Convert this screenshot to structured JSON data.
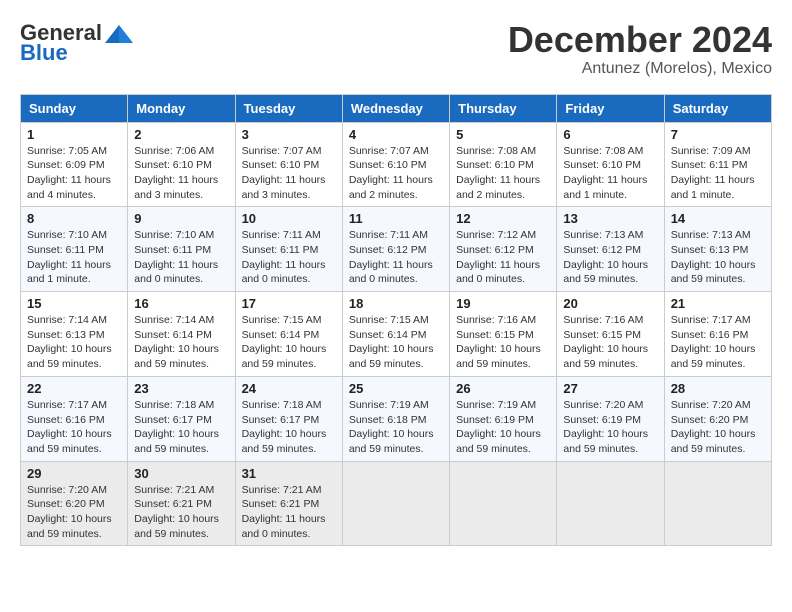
{
  "header": {
    "logo_general": "General",
    "logo_blue": "Blue",
    "month_title": "December 2024",
    "location": "Antunez (Morelos), Mexico"
  },
  "calendar": {
    "days_of_week": [
      "Sunday",
      "Monday",
      "Tuesday",
      "Wednesday",
      "Thursday",
      "Friday",
      "Saturday"
    ],
    "weeks": [
      [
        {
          "day": "",
          "info": ""
        },
        {
          "day": "2",
          "info": "Sunrise: 7:06 AM\nSunset: 6:10 PM\nDaylight: 11 hours\nand 3 minutes."
        },
        {
          "day": "3",
          "info": "Sunrise: 7:07 AM\nSunset: 6:10 PM\nDaylight: 11 hours\nand 3 minutes."
        },
        {
          "day": "4",
          "info": "Sunrise: 7:07 AM\nSunset: 6:10 PM\nDaylight: 11 hours\nand 2 minutes."
        },
        {
          "day": "5",
          "info": "Sunrise: 7:08 AM\nSunset: 6:10 PM\nDaylight: 11 hours\nand 2 minutes."
        },
        {
          "day": "6",
          "info": "Sunrise: 7:08 AM\nSunset: 6:10 PM\nDaylight: 11 hours\nand 1 minute."
        },
        {
          "day": "7",
          "info": "Sunrise: 7:09 AM\nSunset: 6:11 PM\nDaylight: 11 hours\nand 1 minute."
        }
      ],
      [
        {
          "day": "8",
          "info": "Sunrise: 7:10 AM\nSunset: 6:11 PM\nDaylight: 11 hours\nand 1 minute."
        },
        {
          "day": "9",
          "info": "Sunrise: 7:10 AM\nSunset: 6:11 PM\nDaylight: 11 hours\nand 0 minutes."
        },
        {
          "day": "10",
          "info": "Sunrise: 7:11 AM\nSunset: 6:11 PM\nDaylight: 11 hours\nand 0 minutes."
        },
        {
          "day": "11",
          "info": "Sunrise: 7:11 AM\nSunset: 6:12 PM\nDaylight: 11 hours\nand 0 minutes."
        },
        {
          "day": "12",
          "info": "Sunrise: 7:12 AM\nSunset: 6:12 PM\nDaylight: 11 hours\nand 0 minutes."
        },
        {
          "day": "13",
          "info": "Sunrise: 7:13 AM\nSunset: 6:12 PM\nDaylight: 10 hours\nand 59 minutes."
        },
        {
          "day": "14",
          "info": "Sunrise: 7:13 AM\nSunset: 6:13 PM\nDaylight: 10 hours\nand 59 minutes."
        }
      ],
      [
        {
          "day": "15",
          "info": "Sunrise: 7:14 AM\nSunset: 6:13 PM\nDaylight: 10 hours\nand 59 minutes."
        },
        {
          "day": "16",
          "info": "Sunrise: 7:14 AM\nSunset: 6:14 PM\nDaylight: 10 hours\nand 59 minutes."
        },
        {
          "day": "17",
          "info": "Sunrise: 7:15 AM\nSunset: 6:14 PM\nDaylight: 10 hours\nand 59 minutes."
        },
        {
          "day": "18",
          "info": "Sunrise: 7:15 AM\nSunset: 6:14 PM\nDaylight: 10 hours\nand 59 minutes."
        },
        {
          "day": "19",
          "info": "Sunrise: 7:16 AM\nSunset: 6:15 PM\nDaylight: 10 hours\nand 59 minutes."
        },
        {
          "day": "20",
          "info": "Sunrise: 7:16 AM\nSunset: 6:15 PM\nDaylight: 10 hours\nand 59 minutes."
        },
        {
          "day": "21",
          "info": "Sunrise: 7:17 AM\nSunset: 6:16 PM\nDaylight: 10 hours\nand 59 minutes."
        }
      ],
      [
        {
          "day": "22",
          "info": "Sunrise: 7:17 AM\nSunset: 6:16 PM\nDaylight: 10 hours\nand 59 minutes."
        },
        {
          "day": "23",
          "info": "Sunrise: 7:18 AM\nSunset: 6:17 PM\nDaylight: 10 hours\nand 59 minutes."
        },
        {
          "day": "24",
          "info": "Sunrise: 7:18 AM\nSunset: 6:17 PM\nDaylight: 10 hours\nand 59 minutes."
        },
        {
          "day": "25",
          "info": "Sunrise: 7:19 AM\nSunset: 6:18 PM\nDaylight: 10 hours\nand 59 minutes."
        },
        {
          "day": "26",
          "info": "Sunrise: 7:19 AM\nSunset: 6:19 PM\nDaylight: 10 hours\nand 59 minutes."
        },
        {
          "day": "27",
          "info": "Sunrise: 7:20 AM\nSunset: 6:19 PM\nDaylight: 10 hours\nand 59 minutes."
        },
        {
          "day": "28",
          "info": "Sunrise: 7:20 AM\nSunset: 6:20 PM\nDaylight: 10 hours\nand 59 minutes."
        }
      ],
      [
        {
          "day": "29",
          "info": "Sunrise: 7:20 AM\nSunset: 6:20 PM\nDaylight: 10 hours\nand 59 minutes."
        },
        {
          "day": "30",
          "info": "Sunrise: 7:21 AM\nSunset: 6:21 PM\nDaylight: 10 hours\nand 59 minutes."
        },
        {
          "day": "31",
          "info": "Sunrise: 7:21 AM\nSunset: 6:21 PM\nDaylight: 11 hours\nand 0 minutes."
        },
        {
          "day": "",
          "info": ""
        },
        {
          "day": "",
          "info": ""
        },
        {
          "day": "",
          "info": ""
        },
        {
          "day": "",
          "info": ""
        }
      ]
    ],
    "week0_day1": {
      "day": "1",
      "info": "Sunrise: 7:05 AM\nSunset: 6:09 PM\nDaylight: 11 hours\nand 4 minutes."
    }
  }
}
